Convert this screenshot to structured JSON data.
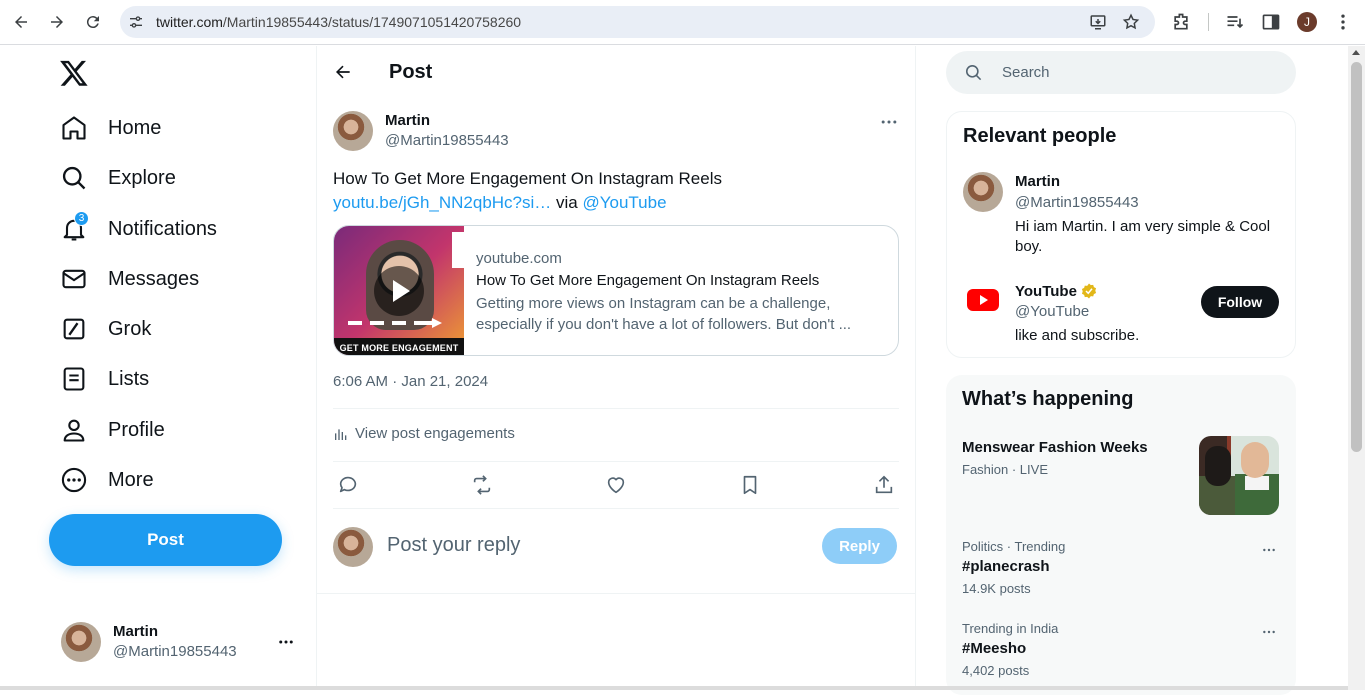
{
  "browser": {
    "url_host": "twitter.com",
    "url_path": "/Martin19855443/status/1749071051420758260",
    "profile_initial": "J"
  },
  "nav": {
    "items": [
      {
        "label": "Home",
        "icon": "home-icon"
      },
      {
        "label": "Explore",
        "icon": "search-icon"
      },
      {
        "label": "Notifications",
        "icon": "bell-icon",
        "badge": "3"
      },
      {
        "label": "Messages",
        "icon": "envelope-icon"
      },
      {
        "label": "Grok",
        "icon": "grok-icon"
      },
      {
        "label": "Lists",
        "icon": "list-icon"
      },
      {
        "label": "Profile",
        "icon": "person-icon"
      },
      {
        "label": "More",
        "icon": "more-circle-icon"
      }
    ],
    "post_button": "Post"
  },
  "account": {
    "name": "Martin",
    "handle": "@Martin19855443"
  },
  "main": {
    "title": "Post",
    "tweet": {
      "author_name": "Martin",
      "author_handle": "@Martin19855443",
      "text": "How To Get More Engagement On Instagram Reels",
      "link_text": "youtu.be/jGh_NN2qbHc?si…",
      "via": "via",
      "mention": "@YouTube",
      "card": {
        "domain": "youtube.com",
        "title": "How To Get More Engagement On Instagram Reels",
        "description": "Getting more views on Instagram can be a challenge, especially if you don't have a lot of followers. But don't ...",
        "thumb_caption": "GET MORE ENGAGEMENT"
      },
      "timestamp": "6:06 AM · Jan 21, 2024",
      "engagements": "View post engagements"
    },
    "reply": {
      "placeholder": "Post your reply",
      "button": "Reply"
    }
  },
  "right": {
    "search_placeholder": "Search",
    "relevant": {
      "title": "Relevant people",
      "people": [
        {
          "name": "Martin",
          "handle": "@Martin19855443",
          "bio": "Hi iam Martin. I am very simple & Cool boy."
        },
        {
          "name": "YouTube",
          "handle": "@YouTube",
          "bio": "like and subscribe.",
          "follow": "Follow"
        }
      ]
    },
    "happening": {
      "title": "What’s happening",
      "feature": {
        "title": "Menswear Fashion Weeks",
        "meta": "Fashion · LIVE"
      },
      "trends": [
        {
          "meta": "Politics · Trending",
          "title": "#planecrash",
          "count": "14.9K posts"
        },
        {
          "meta": "Trending in India",
          "title": "#Meesho",
          "count": "4,402 posts"
        }
      ]
    }
  },
  "colors": {
    "accent": "#1d9bf0",
    "text": "#0f1419",
    "secondary": "#536471"
  }
}
